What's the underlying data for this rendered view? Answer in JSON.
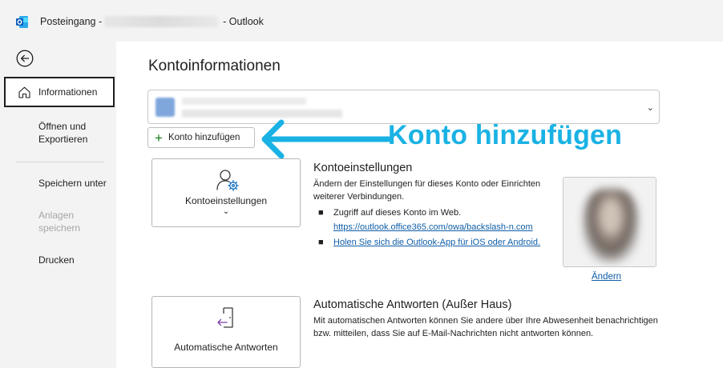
{
  "titlebar": {
    "title_prefix": "Posteingang -",
    "title_suffix": "-  Outlook",
    "icon": "outlook-icon"
  },
  "sidebar": {
    "back_icon": "back-arrow-icon",
    "items": [
      {
        "label": "Informationen",
        "icon": "home-icon",
        "active": true
      },
      {
        "label": "Öffnen und Exportieren"
      },
      {
        "label": "Speichern unter"
      },
      {
        "label": "Anlagen speichern",
        "disabled": true
      },
      {
        "label": "Drucken"
      }
    ]
  },
  "main": {
    "title": "Kontoinformationen",
    "add_account_label": "Konto hinzufügen",
    "annotation_label": "Konto hinzufügen",
    "annotation_color": "#1ab2e4",
    "account_settings": {
      "card_label": "Kontoeinstellungen",
      "title": "Kontoeinstellungen",
      "description": "Ändern der Einstellungen für dieses Konto oder Einrichten weiterer Verbindungen.",
      "bullet1_text": "Zugriff auf dieses Konto im Web.",
      "bullet1_link": "https://outlook.office365.com/owa/backslash-n.com",
      "bullet2_link": "Holen Sie sich die Outlook-App für iOS oder Android.",
      "photo_change_link": "Ändern"
    },
    "auto_replies": {
      "card_label": "Automatische Antworten",
      "title": "Automatische Antworten (Außer Haus)",
      "description": "Mit automatischen Antworten können Sie andere über Ihre Abwesenheit benachrichtigen bzw. mitteilen, dass Sie auf E-Mail-Nachrichten nicht antworten können."
    }
  },
  "colors": {
    "accent": "#0f5ea8",
    "add_plus": "#107c10",
    "sidebar_bg": "#f3f3f3"
  }
}
